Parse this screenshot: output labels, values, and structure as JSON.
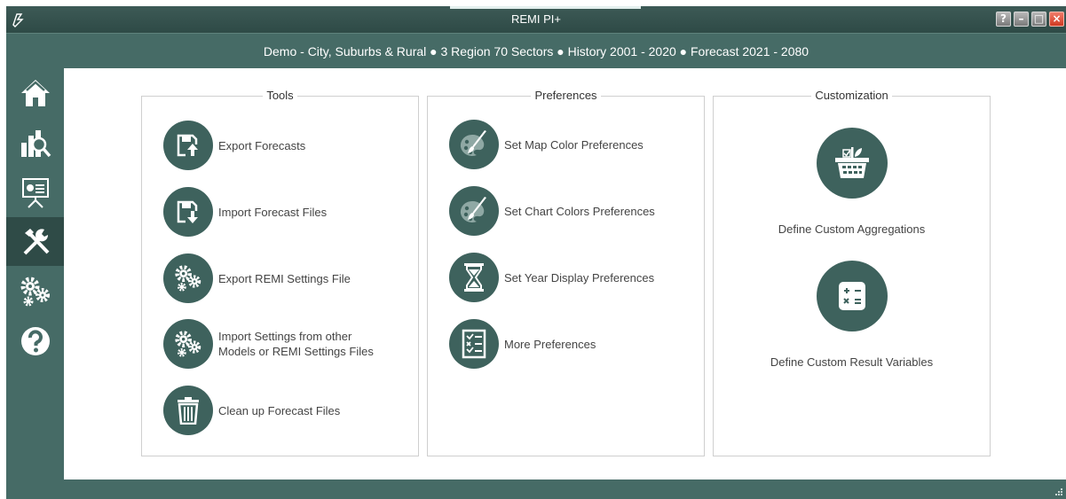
{
  "window": {
    "title": "REMI PI+"
  },
  "model_info": "Demo - City, Suburbs & Rural ● 3 Region 70 Sectors ● History 2001 - 2020 ● Forecast 2021 - 2080",
  "sidebar": {
    "items": [
      {
        "icon": "home-icon",
        "active": false
      },
      {
        "icon": "chart-icon",
        "active": false
      },
      {
        "icon": "presentation-icon",
        "active": false
      },
      {
        "icon": "tools-icon",
        "active": true
      },
      {
        "icon": "gears-icon",
        "active": false
      },
      {
        "icon": "help-icon",
        "active": false
      }
    ]
  },
  "panels": {
    "tools": {
      "title": "Tools",
      "items": [
        {
          "label": "Export Forecasts",
          "icon": "export-forecast-icon"
        },
        {
          "label": "Import Forecast Files",
          "icon": "import-forecast-icon"
        },
        {
          "label": "Export REMI Settings File",
          "icon": "gears-icon"
        },
        {
          "label": "Import Settings from other\nModels or REMI Settings Files",
          "icon": "gears-icon"
        },
        {
          "label": "Clean up Forecast Files",
          "icon": "trash-icon"
        }
      ]
    },
    "preferences": {
      "title": "Preferences",
      "items": [
        {
          "label": "Set Map Color Preferences",
          "icon": "palette-icon"
        },
        {
          "label": "Set Chart Colors Preferences",
          "icon": "palette-icon"
        },
        {
          "label": "Set Year Display Preferences",
          "icon": "hourglass-icon"
        },
        {
          "label": "More Preferences",
          "icon": "checklist-icon"
        }
      ]
    },
    "customization": {
      "title": "Customization",
      "items": [
        {
          "label": "Define Custom Aggregations",
          "icon": "basket-icon"
        },
        {
          "label": "Define Custom Result Variables",
          "icon": "calculator-icon"
        }
      ]
    }
  },
  "colors": {
    "primary": "#466b66",
    "dark": "#2f4b47",
    "icon_circle": "#3e625d"
  }
}
